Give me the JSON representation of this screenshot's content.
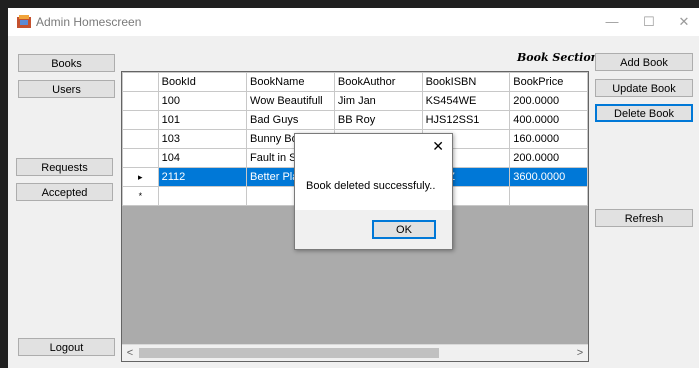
{
  "window": {
    "title": "Admin Homescreen",
    "controls": {
      "minimize": "—",
      "maximize": "☐",
      "close": "✕"
    }
  },
  "left_nav": {
    "books": "Books",
    "users": "Users",
    "requests": "Requests",
    "accepted": "Accepted",
    "logout": "Logout"
  },
  "section_label": "Book Section",
  "right_actions": {
    "add_book": "Add Book",
    "update_book": "Update Book",
    "delete_book": "Delete Book",
    "refresh": "Refresh"
  },
  "grid": {
    "columns": [
      "BookId",
      "BookName",
      "BookAuthor",
      "BookISBN",
      "BookPrice"
    ],
    "rows": [
      [
        "100",
        "Wow Beautifull",
        "Jim Jan",
        "KS454WE",
        "200.0000"
      ],
      [
        "101",
        "Bad Guys",
        "BB Roy",
        "HJS12SS1",
        "400.0000"
      ],
      [
        "103",
        "Bunny Bom",
        "",
        "5AS3",
        "160.0000"
      ],
      [
        "104",
        "Fault in Sta",
        "",
        "5ED2",
        "200.0000"
      ],
      [
        "2112",
        "Better Plac",
        "",
        "SCSZ",
        "3600.0000"
      ]
    ],
    "selected_row_indicator": "▸",
    "new_row_indicator": "*",
    "scroll_left": "<",
    "scroll_right": ">"
  },
  "dialog": {
    "message": "Book deleted successfuly..",
    "ok": "OK",
    "close": "✕"
  },
  "colors": {
    "selection": "#0078d7",
    "grid_background": "#ababab",
    "window_background": "#f0f0f0"
  }
}
